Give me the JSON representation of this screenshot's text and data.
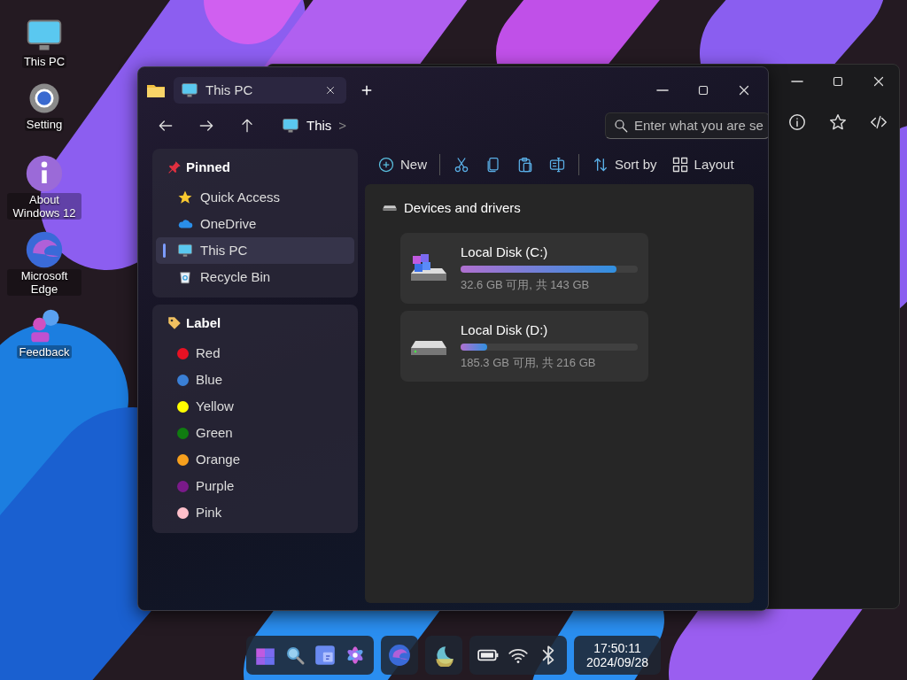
{
  "desktop_icons": [
    {
      "label": "This PC",
      "kind": "monitor"
    },
    {
      "label": "Setting",
      "kind": "gear"
    },
    {
      "label": "About Windows 12",
      "kind": "info"
    },
    {
      "label": "Microsoft Edge",
      "kind": "edge"
    },
    {
      "label": "Feedback",
      "kind": "feedback"
    }
  ],
  "explorer": {
    "tabs": [
      {
        "label": "This PC",
        "selected": true
      }
    ],
    "address": {
      "segment": "This",
      "separator": ">"
    },
    "search": {
      "placeholder": "Enter what you are se"
    },
    "sidebar": {
      "pinned": {
        "title": "Pinned",
        "items": [
          {
            "label": "Quick Access",
            "kind": "star",
            "selected": false
          },
          {
            "label": "OneDrive",
            "kind": "cloud",
            "selected": false
          },
          {
            "label": "This PC",
            "kind": "monitor",
            "selected": true
          },
          {
            "label": "Recycle Bin",
            "kind": "bin",
            "selected": false
          }
        ]
      },
      "labels": {
        "title": "Label",
        "items": [
          {
            "label": "Red",
            "color": "#e81123"
          },
          {
            "label": "Blue",
            "color": "#3a7fd5"
          },
          {
            "label": "Yellow",
            "color": "#ffff00"
          },
          {
            "label": "Green",
            "color": "#107c10"
          },
          {
            "label": "Orange",
            "color": "#f7a01d"
          },
          {
            "label": "Purple",
            "color": "#7a1a8a"
          },
          {
            "label": "Pink",
            "color": "#ffc0cb"
          }
        ]
      }
    },
    "toolbar": [
      {
        "kind": "new",
        "label": "New"
      },
      {
        "kind": "separator"
      },
      {
        "kind": "cut"
      },
      {
        "kind": "copy"
      },
      {
        "kind": "paste"
      },
      {
        "kind": "rename"
      },
      {
        "kind": "separator"
      },
      {
        "kind": "sort",
        "label": "Sort by"
      },
      {
        "kind": "layout",
        "label": "Layout"
      }
    ],
    "section_title": "Devices and drivers",
    "drives": [
      {
        "name": "Local Disk (C:)",
        "kind": "system",
        "level": 0.88,
        "reading": "32.6 GB 可用, 共 143 GB"
      },
      {
        "name": "Local Disk (D:)",
        "kind": "data",
        "level": 0.15,
        "reading": "185.3 GB 可用, 共 216 GB"
      }
    ]
  },
  "taskbar": {
    "clock": {
      "time": "17:50:11",
      "date": "2024/09/28"
    }
  }
}
